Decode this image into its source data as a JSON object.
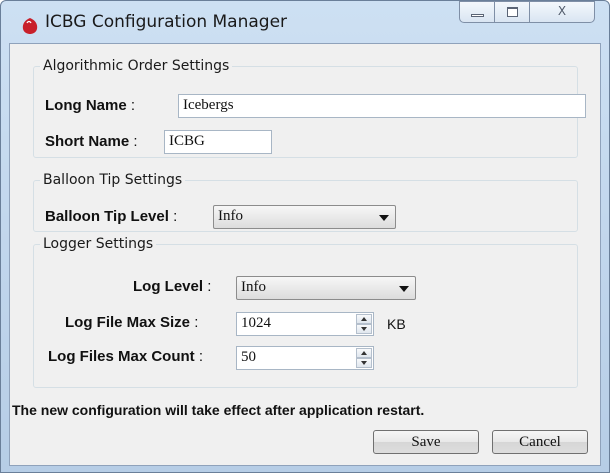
{
  "window": {
    "title": "ICBG  Configuration Manager",
    "close_glyph": "X"
  },
  "algorithmic": {
    "legend": "Algorithmic Order Settings",
    "long_name_label": "Long Name",
    "long_name_value": "Icebergs",
    "short_name_label": "Short Name",
    "short_name_value": "ICBG"
  },
  "balloon": {
    "legend": "Balloon Tip Settings",
    "level_label": "Balloon Tip Level",
    "level_value": "Info"
  },
  "logger": {
    "legend": "Logger Settings",
    "log_level_label": "Log Level",
    "log_level_value": "Info",
    "max_size_label": "Log File Max Size",
    "max_size_value": "1024",
    "max_size_unit": "KB",
    "max_count_label": "Log Files Max Count",
    "max_count_value": "50"
  },
  "colon": ":",
  "notice": "The new configuration will take effect after application restart.",
  "buttons": {
    "save": "Save",
    "cancel": "Cancel"
  },
  "colors": {
    "app_icon": "#c8202b",
    "title_bar": "#c4d9ee"
  }
}
